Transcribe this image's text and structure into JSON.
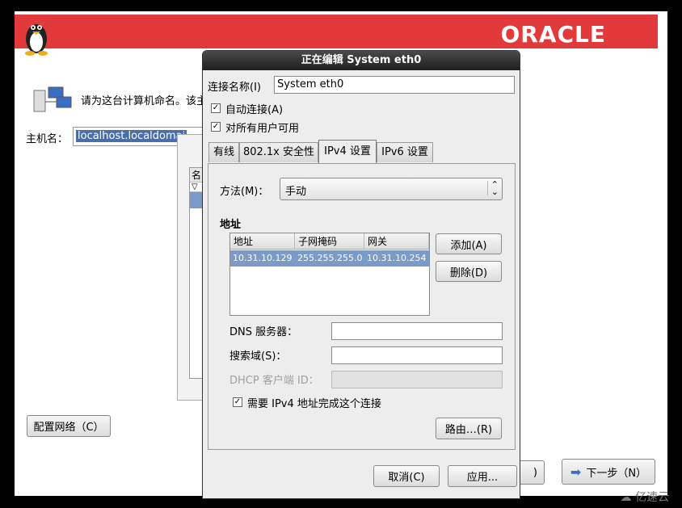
{
  "installer": {
    "brand": "ORACLE",
    "hostname_prompt": "请为这台计算机命名。该主",
    "hostname_label": "主机名：",
    "hostname_value": "localhost.localdomai",
    "configure_network_button": "配置网络（C）",
    "next_button": "下一步（N）",
    "back_button_fragment": ")",
    "panel_header_fragment": "名",
    "panel_arrow": "▽"
  },
  "dialog": {
    "title": "正在编辑 System eth0",
    "connection_name_label": "连接名称(I)",
    "connection_name_value": "System eth0",
    "auto_connect_label": "自动连接(A)",
    "all_users_label": "对所有用户可用",
    "tabs": [
      {
        "label": "有线"
      },
      {
        "label": "802.1x 安全性"
      },
      {
        "label": "IPv4 设置"
      },
      {
        "label": "IPv6 设置"
      }
    ],
    "method_label": "方法(M)：",
    "method_value": "手动",
    "address_section": "地址",
    "address_table": {
      "headers": [
        "地址",
        "子网掩码",
        "网关"
      ],
      "rows": [
        [
          "10.31.10.129",
          "255.255.255.0",
          "10.31.10.254"
        ]
      ]
    },
    "add_button": "添加(A)",
    "delete_button": "删除(D)",
    "dns_label": "DNS 服务器：",
    "dns_value": "",
    "search_label": "搜索域(S)：",
    "search_value": "",
    "dhcp_label": "DHCP 客户端 ID：",
    "dhcp_value": "",
    "require_ipv4_label": "需要 IPv4 地址完成这个连接",
    "routes_button": "路由…(R)",
    "cancel_button": "取消(C)",
    "apply_button": "应用..."
  },
  "watermark": "亿速云",
  "colors": {
    "banner": "#e23a3a",
    "selection": "#7a9ac8",
    "titlebar": "#2a2a2a"
  }
}
